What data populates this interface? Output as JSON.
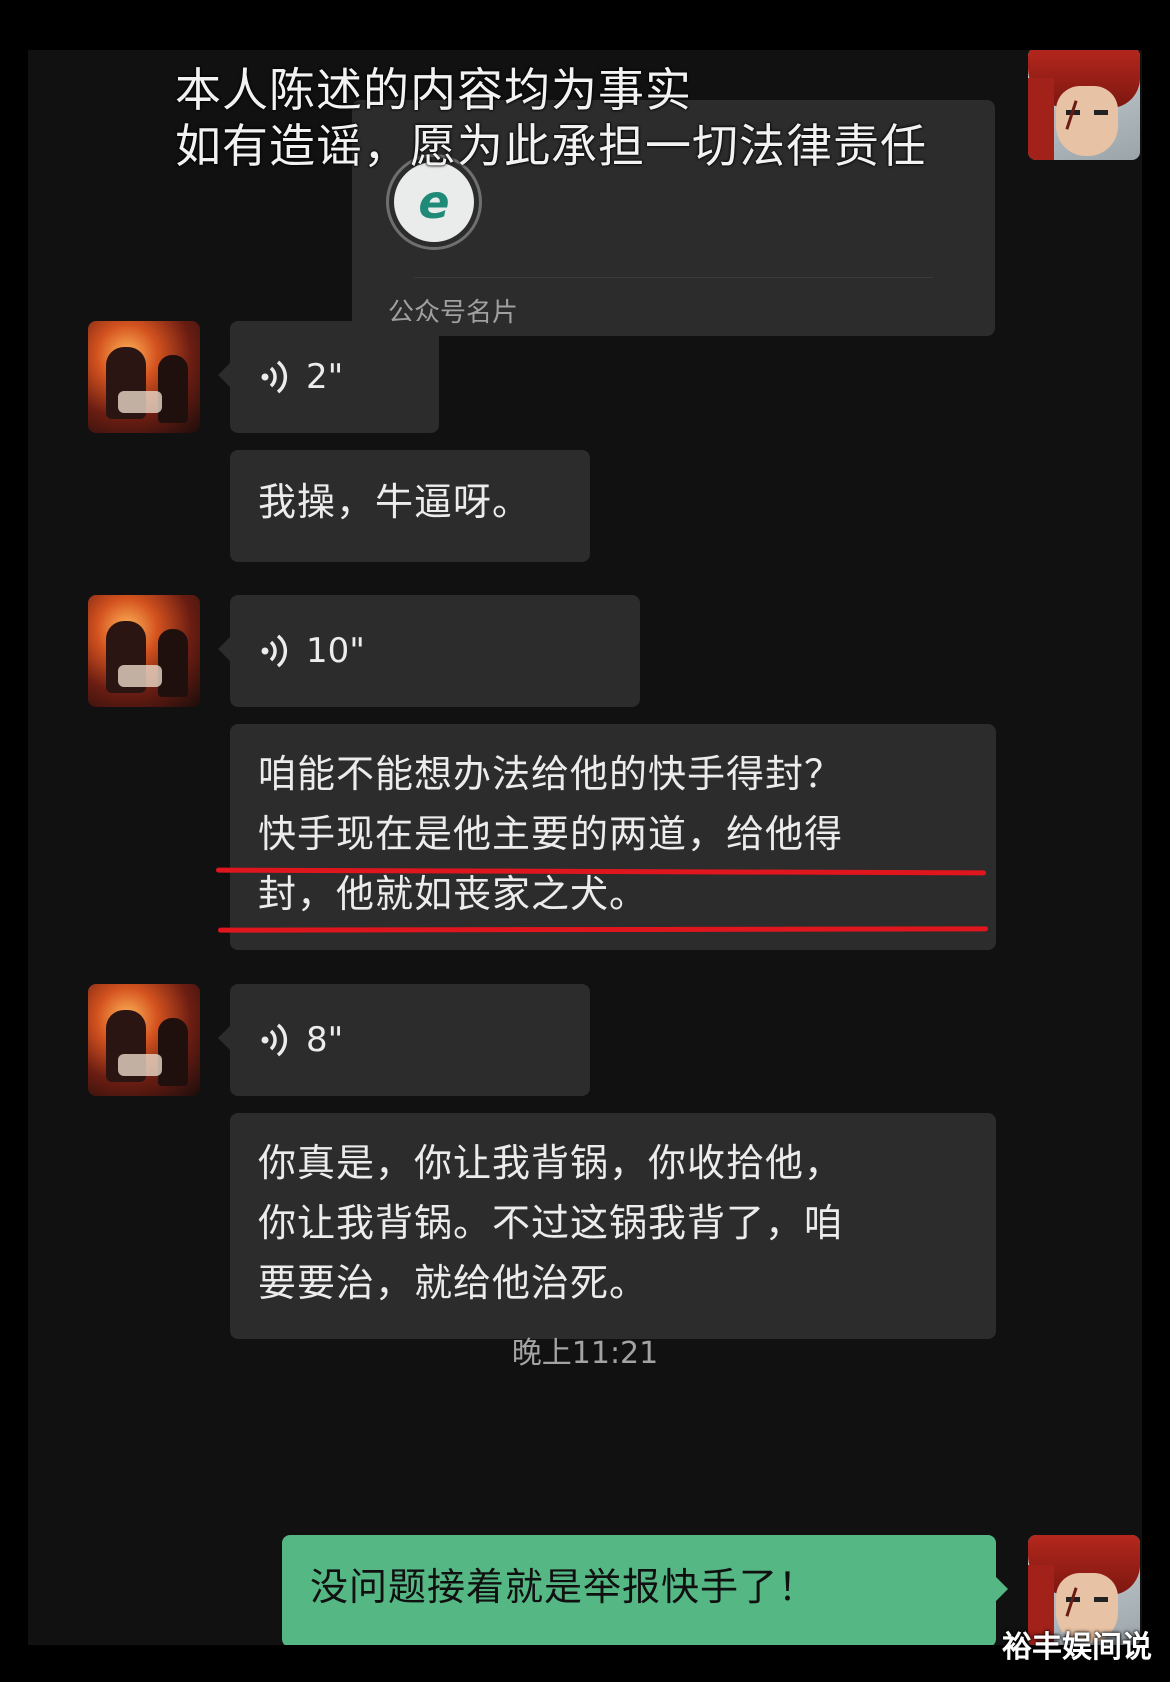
{
  "overlay_caption": {
    "line1": "本人陈述的内容均为事实",
    "line2": "如有造谣，愿为此承担一切法律责任"
  },
  "shared_card": {
    "logo_glyph": "e",
    "label": "公众号名片"
  },
  "messages": [
    {
      "type": "voice",
      "duration": "2\""
    },
    {
      "type": "text",
      "text": "我操，牛逼呀。"
    },
    {
      "type": "voice",
      "duration": "10\""
    },
    {
      "type": "text",
      "lines": [
        "咱能不能想办法给他的快手得封？",
        "快手现在是他主要的两道，给他得",
        "封，他就如丧家之犬。"
      ],
      "highlight_color": "#e0161e"
    },
    {
      "type": "voice",
      "duration": "8\""
    },
    {
      "type": "text",
      "lines": [
        "你真是，你让我背锅，你收拾他，",
        "你让我背锅。不过这锅我背了，咱",
        "要要治，就给他治死。"
      ]
    }
  ],
  "timestamp": "晚上11:21",
  "self_message": "没问题接着就是举报快手了！",
  "watermark": "裕丰娱间说",
  "colors": {
    "background": "#111111",
    "bubble_other": "#2c2c2c",
    "bubble_self": "#54b784",
    "underline": "#e0161e"
  },
  "icons": {
    "voice": "voice-wave-icon",
    "avatar_other": "avatar-photo",
    "avatar_self": "avatar-anime"
  }
}
